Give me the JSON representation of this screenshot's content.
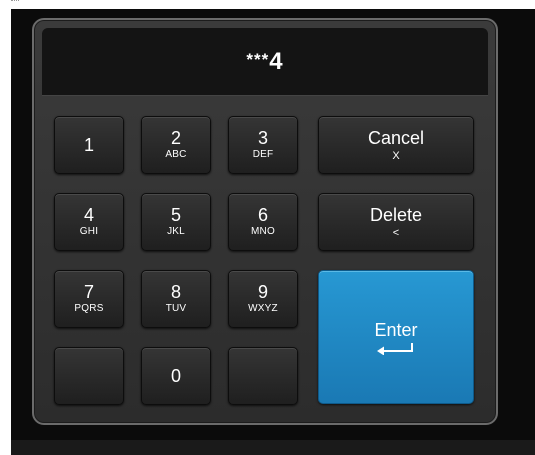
{
  "display": {
    "mask": "***",
    "last_digit": "4"
  },
  "keys": {
    "k1": {
      "num": "1",
      "sub": ""
    },
    "k2": {
      "num": "2",
      "sub": "ABC"
    },
    "k3": {
      "num": "3",
      "sub": "DEF"
    },
    "k4": {
      "num": "4",
      "sub": "GHI"
    },
    "k5": {
      "num": "5",
      "sub": "JKL"
    },
    "k6": {
      "num": "6",
      "sub": "MNO"
    },
    "k7": {
      "num": "7",
      "sub": "PQRS"
    },
    "k8": {
      "num": "8",
      "sub": "TUV"
    },
    "k9": {
      "num": "9",
      "sub": "WXYZ"
    },
    "k0": {
      "num": "0",
      "sub": ""
    }
  },
  "actions": {
    "cancel": {
      "label": "Cancel",
      "sub": "X"
    },
    "delete": {
      "label": "Delete",
      "sub": "<"
    },
    "enter": {
      "label": "Enter",
      "icon": "return-arrow-icon"
    }
  },
  "colors": {
    "enter_key": "#1f8ac5",
    "panel": "#333333",
    "background": "#0b0b0b"
  }
}
